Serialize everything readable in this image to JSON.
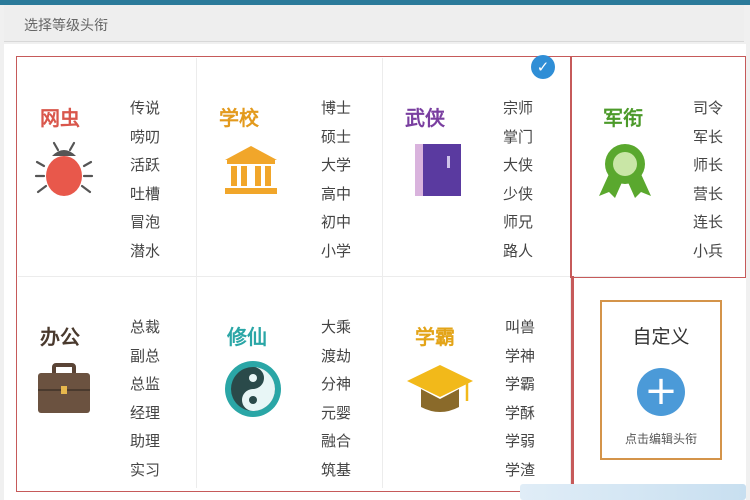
{
  "header": {
    "title": "选择等级头衔"
  },
  "categories": [
    {
      "name": "网虫",
      "color": "#d9574c",
      "icon": "bug-icon",
      "items": [
        "传说",
        "唠叨",
        "活跃",
        "吐槽",
        "冒泡",
        "潜水"
      ]
    },
    {
      "name": "学校",
      "color": "#e39a1d",
      "icon": "school-building-icon",
      "items": [
        "博士",
        "硕士",
        "大学",
        "高中",
        "初中",
        "小学"
      ]
    },
    {
      "name": "武侠",
      "color": "#7a3fa0",
      "icon": "book-icon",
      "items": [
        "宗师",
        "掌门",
        "大侠",
        "少侠",
        "师兄",
        "路人"
      ],
      "selected": true
    },
    {
      "name": "军衔",
      "color": "#4c9a2a",
      "icon": "medal-ribbon-icon",
      "items": [
        "司令",
        "军长",
        "师长",
        "营长",
        "连长",
        "小兵"
      ]
    },
    {
      "name": "办公",
      "color": "#4a3a2e",
      "icon": "briefcase-icon",
      "items": [
        "总裁",
        "副总",
        "总监",
        "经理",
        "助理",
        "实习"
      ]
    },
    {
      "name": "修仙",
      "color": "#2aa6a6",
      "icon": "yin-yang-icon",
      "items": [
        "大乘",
        "渡劫",
        "分神",
        "元婴",
        "融合",
        "筑基"
      ]
    },
    {
      "name": "学霸",
      "color": "#e3a418",
      "icon": "graduation-cap-icon",
      "items": [
        "叫兽",
        "学神",
        "学霸",
        "学酥",
        "学弱",
        "学渣"
      ]
    }
  ],
  "custom": {
    "title": "自定义",
    "hint": "点击编辑头衔",
    "icon": "plus-icon"
  },
  "selected_icon": "checkmark-icon"
}
